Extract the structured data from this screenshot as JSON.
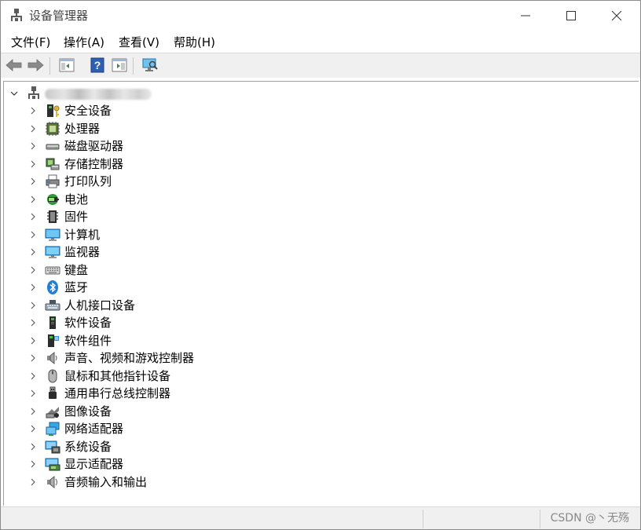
{
  "window": {
    "title": "设备管理器"
  },
  "menu": {
    "items": [
      "文件(F)",
      "操作(A)",
      "查看(V)",
      "帮助(H)"
    ]
  },
  "toolbar": {
    "buttons": [
      "back-arrow-icon",
      "forward-arrow-icon",
      "show-hide-tree-icon",
      "help-icon",
      "properties-icon",
      "scan-hardware-icon"
    ]
  },
  "tree": {
    "root": {
      "label": "",
      "icon": "computer-root-icon",
      "expanded": true
    },
    "categories": [
      {
        "label": "安全设备",
        "icon": "security-device-icon"
      },
      {
        "label": "处理器",
        "icon": "processor-icon"
      },
      {
        "label": "磁盘驱动器",
        "icon": "disk-drive-icon"
      },
      {
        "label": "存储控制器",
        "icon": "storage-controller-icon"
      },
      {
        "label": "打印队列",
        "icon": "printer-icon"
      },
      {
        "label": "电池",
        "icon": "battery-icon"
      },
      {
        "label": "固件",
        "icon": "firmware-icon"
      },
      {
        "label": "计算机",
        "icon": "computer-icon"
      },
      {
        "label": "监视器",
        "icon": "monitor-icon"
      },
      {
        "label": "键盘",
        "icon": "keyboard-icon"
      },
      {
        "label": "蓝牙",
        "icon": "bluetooth-icon"
      },
      {
        "label": "人机接口设备",
        "icon": "hid-icon"
      },
      {
        "label": "软件设备",
        "icon": "software-device-icon"
      },
      {
        "label": "软件组件",
        "icon": "software-component-icon"
      },
      {
        "label": "声音、视频和游戏控制器",
        "icon": "sound-icon"
      },
      {
        "label": "鼠标和其他指针设备",
        "icon": "mouse-icon"
      },
      {
        "label": "通用串行总线控制器",
        "icon": "usb-icon"
      },
      {
        "label": "图像设备",
        "icon": "camera-icon"
      },
      {
        "label": "网络适配器",
        "icon": "network-adapter-icon"
      },
      {
        "label": "系统设备",
        "icon": "system-device-icon"
      },
      {
        "label": "显示适配器",
        "icon": "display-adapter-icon"
      },
      {
        "label": "音频输入和输出",
        "icon": "audio-io-icon"
      }
    ]
  },
  "status": {
    "watermark": "CSDN @丶无殇"
  }
}
